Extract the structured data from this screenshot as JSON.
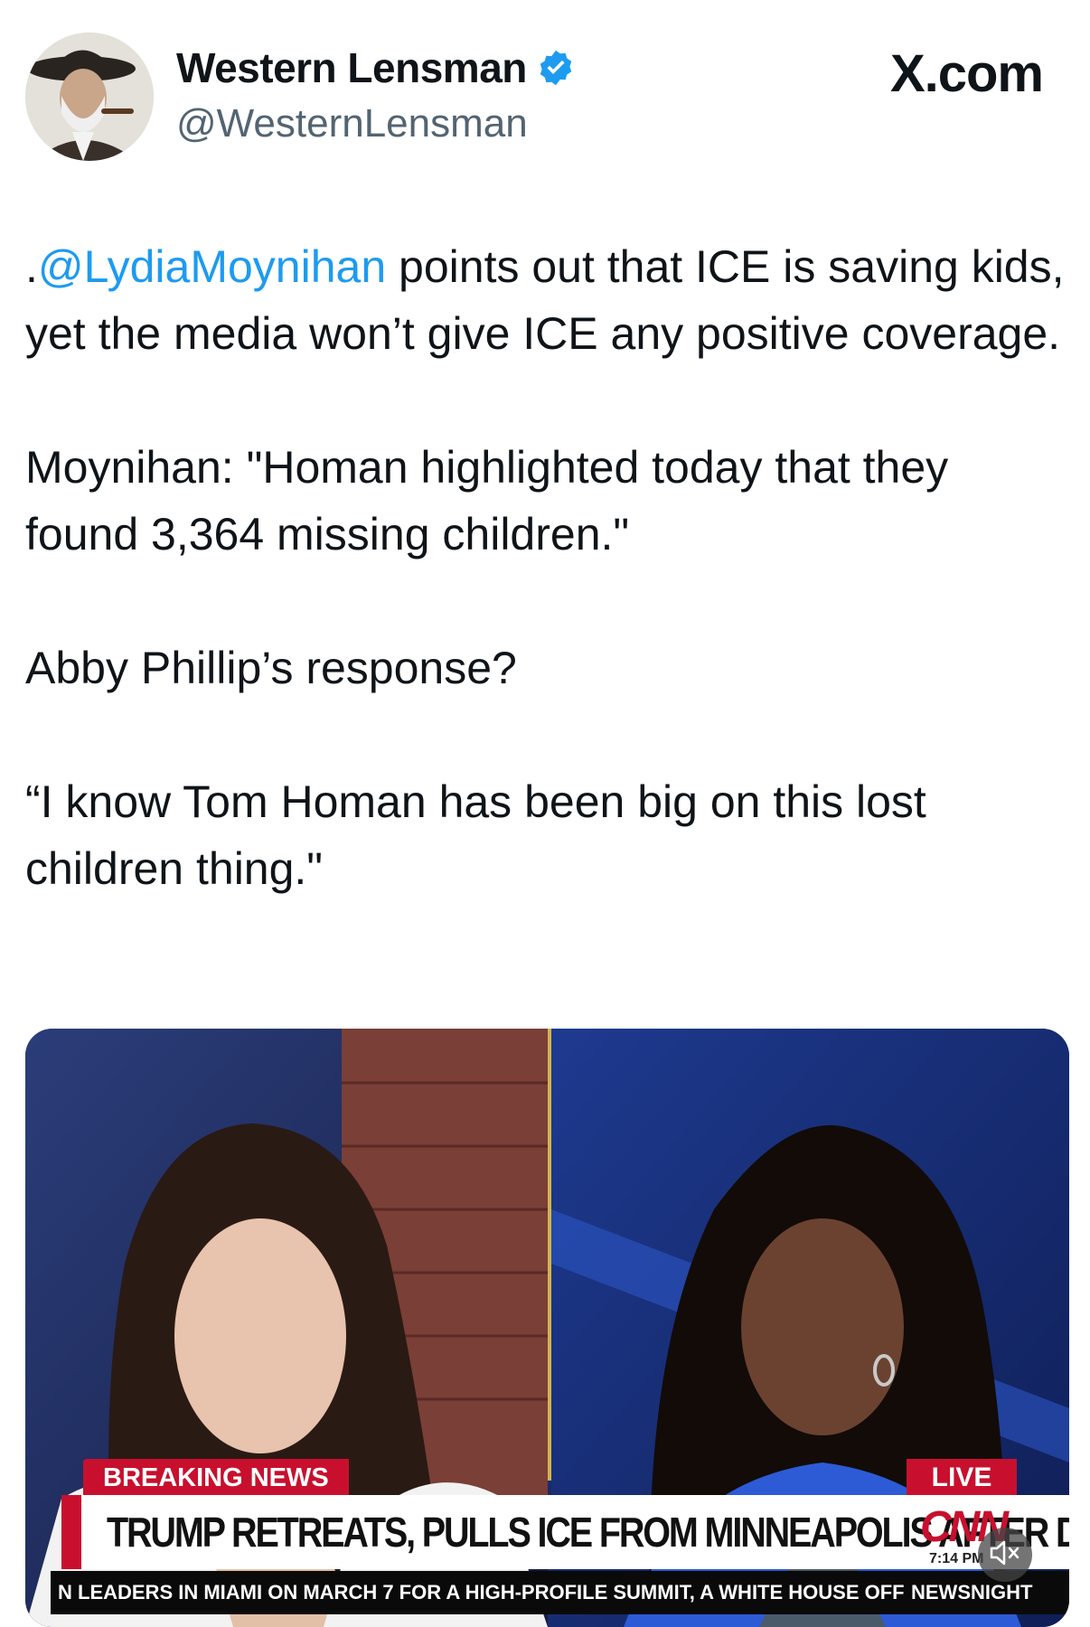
{
  "author": {
    "display_name": "Western Lensman",
    "handle": "@WesternLensman",
    "verified": true
  },
  "site_label": "X.com",
  "tweet": {
    "paragraph1": {
      "prefix": ".",
      "mention": "@LydiaMoynihan",
      "text": " points out that ICE is saving kids, yet the media won’t give ICE any positive coverage."
    },
    "paragraph2": "Moynihan: \"Homan highlighted today that they found 3,364 missing children.\"",
    "paragraph3": "Abby Phillip’s response?",
    "paragraph4": "“I know Tom Homan has been big on this lost children thing.\""
  },
  "video": {
    "badge_breaking": "BREAKING NEWS",
    "badge_live": "LIVE",
    "headline": "TRUMP RETREATS, PULLS ICE FROM MINNEAPOLIS AFTER DEADLY CHAOS",
    "network": "CNN",
    "time": "7:14 PM",
    "ticker": "N LEADERS IN MIAMI ON MARCH 7 FOR A HIGH-PROFILE SUMMIT, A WHITE HOUSE OFF",
    "ticker_show": "NEWSNIGHT",
    "mute_icon": "speaker-muted-icon"
  },
  "colors": {
    "mention": "#1d9bf0",
    "verified": "#1d9bf0",
    "cnn_red": "#c8102e",
    "handle_gray": "#536471"
  }
}
